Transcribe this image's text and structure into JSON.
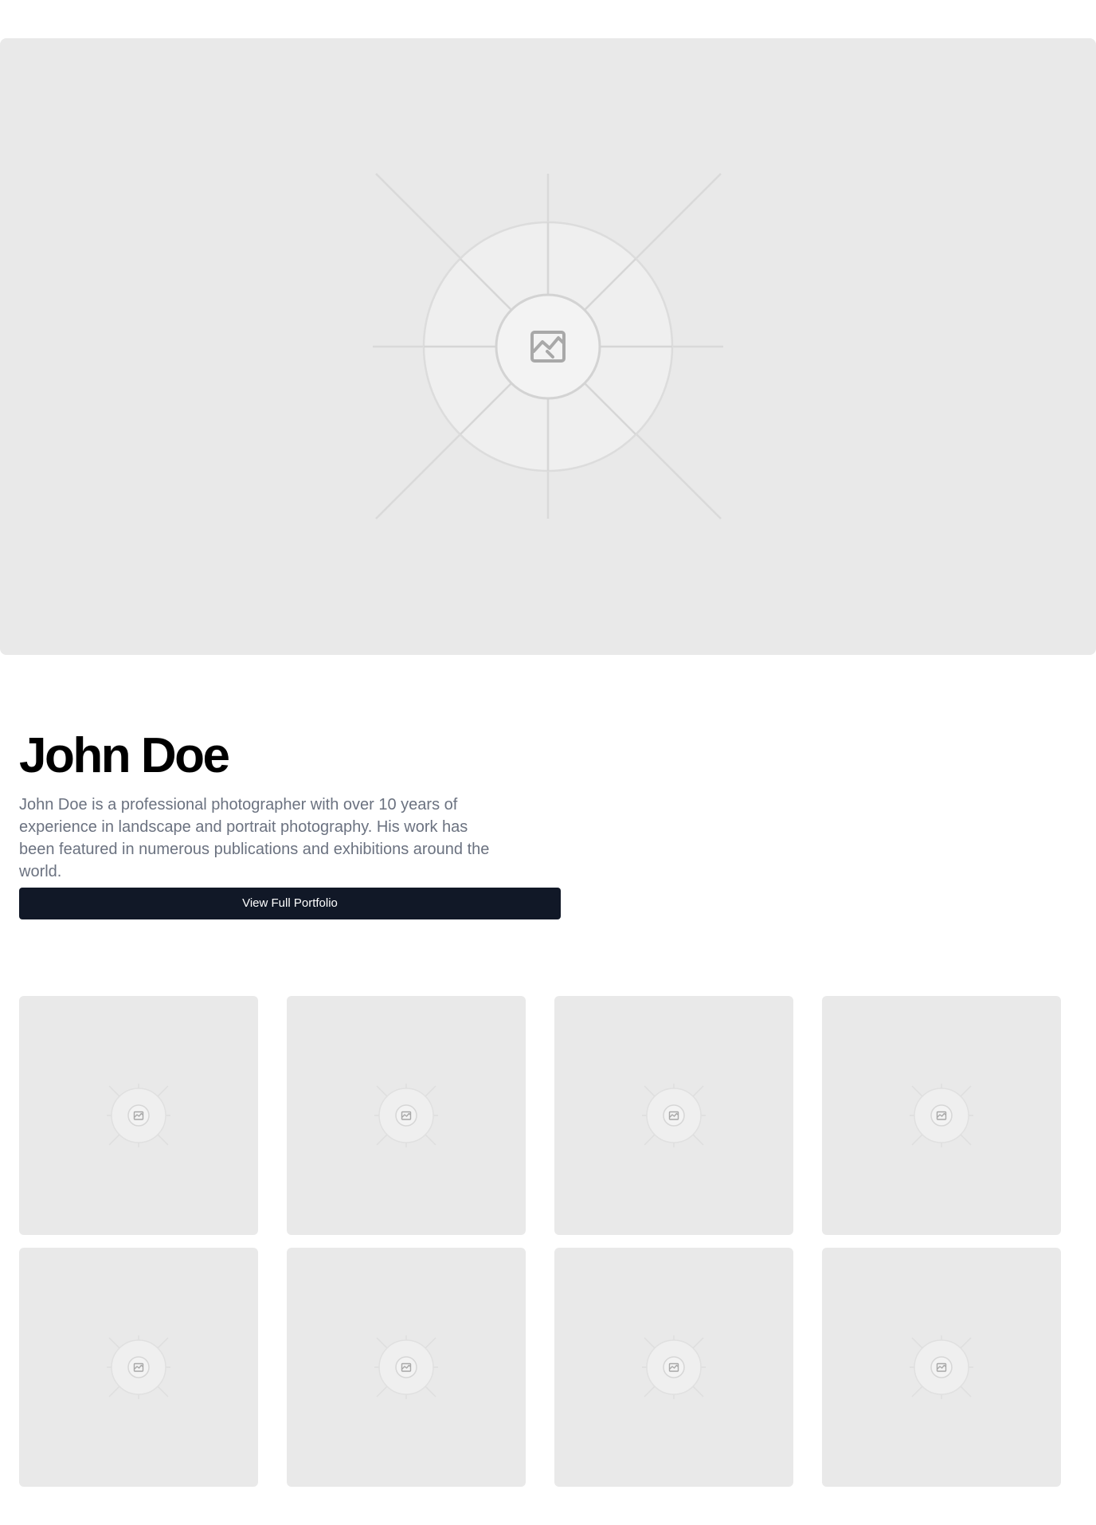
{
  "profile": {
    "name": "John Doe",
    "bio": "John Doe is a professional photographer with over 10 years of experience in landscape and portrait photography. His work has been featured in numerous publications and exhibitions around the world.",
    "cta_label": "View Full Portfolio"
  },
  "hero_image": {
    "icon": "image-placeholder-icon"
  },
  "gallery": {
    "items": [
      {
        "icon": "image-placeholder-icon"
      },
      {
        "icon": "image-placeholder-icon"
      },
      {
        "icon": "image-placeholder-icon"
      },
      {
        "icon": "image-placeholder-icon"
      },
      {
        "icon": "image-placeholder-icon"
      },
      {
        "icon": "image-placeholder-icon"
      },
      {
        "icon": "image-placeholder-icon"
      },
      {
        "icon": "image-placeholder-icon"
      }
    ]
  },
  "colors": {
    "page_background": "#ffffff",
    "placeholder_background": "#e9e9e9",
    "button_background": "#111827",
    "button_text": "#ffffff",
    "bio_text": "#6b7280",
    "heading_text": "#000000"
  }
}
